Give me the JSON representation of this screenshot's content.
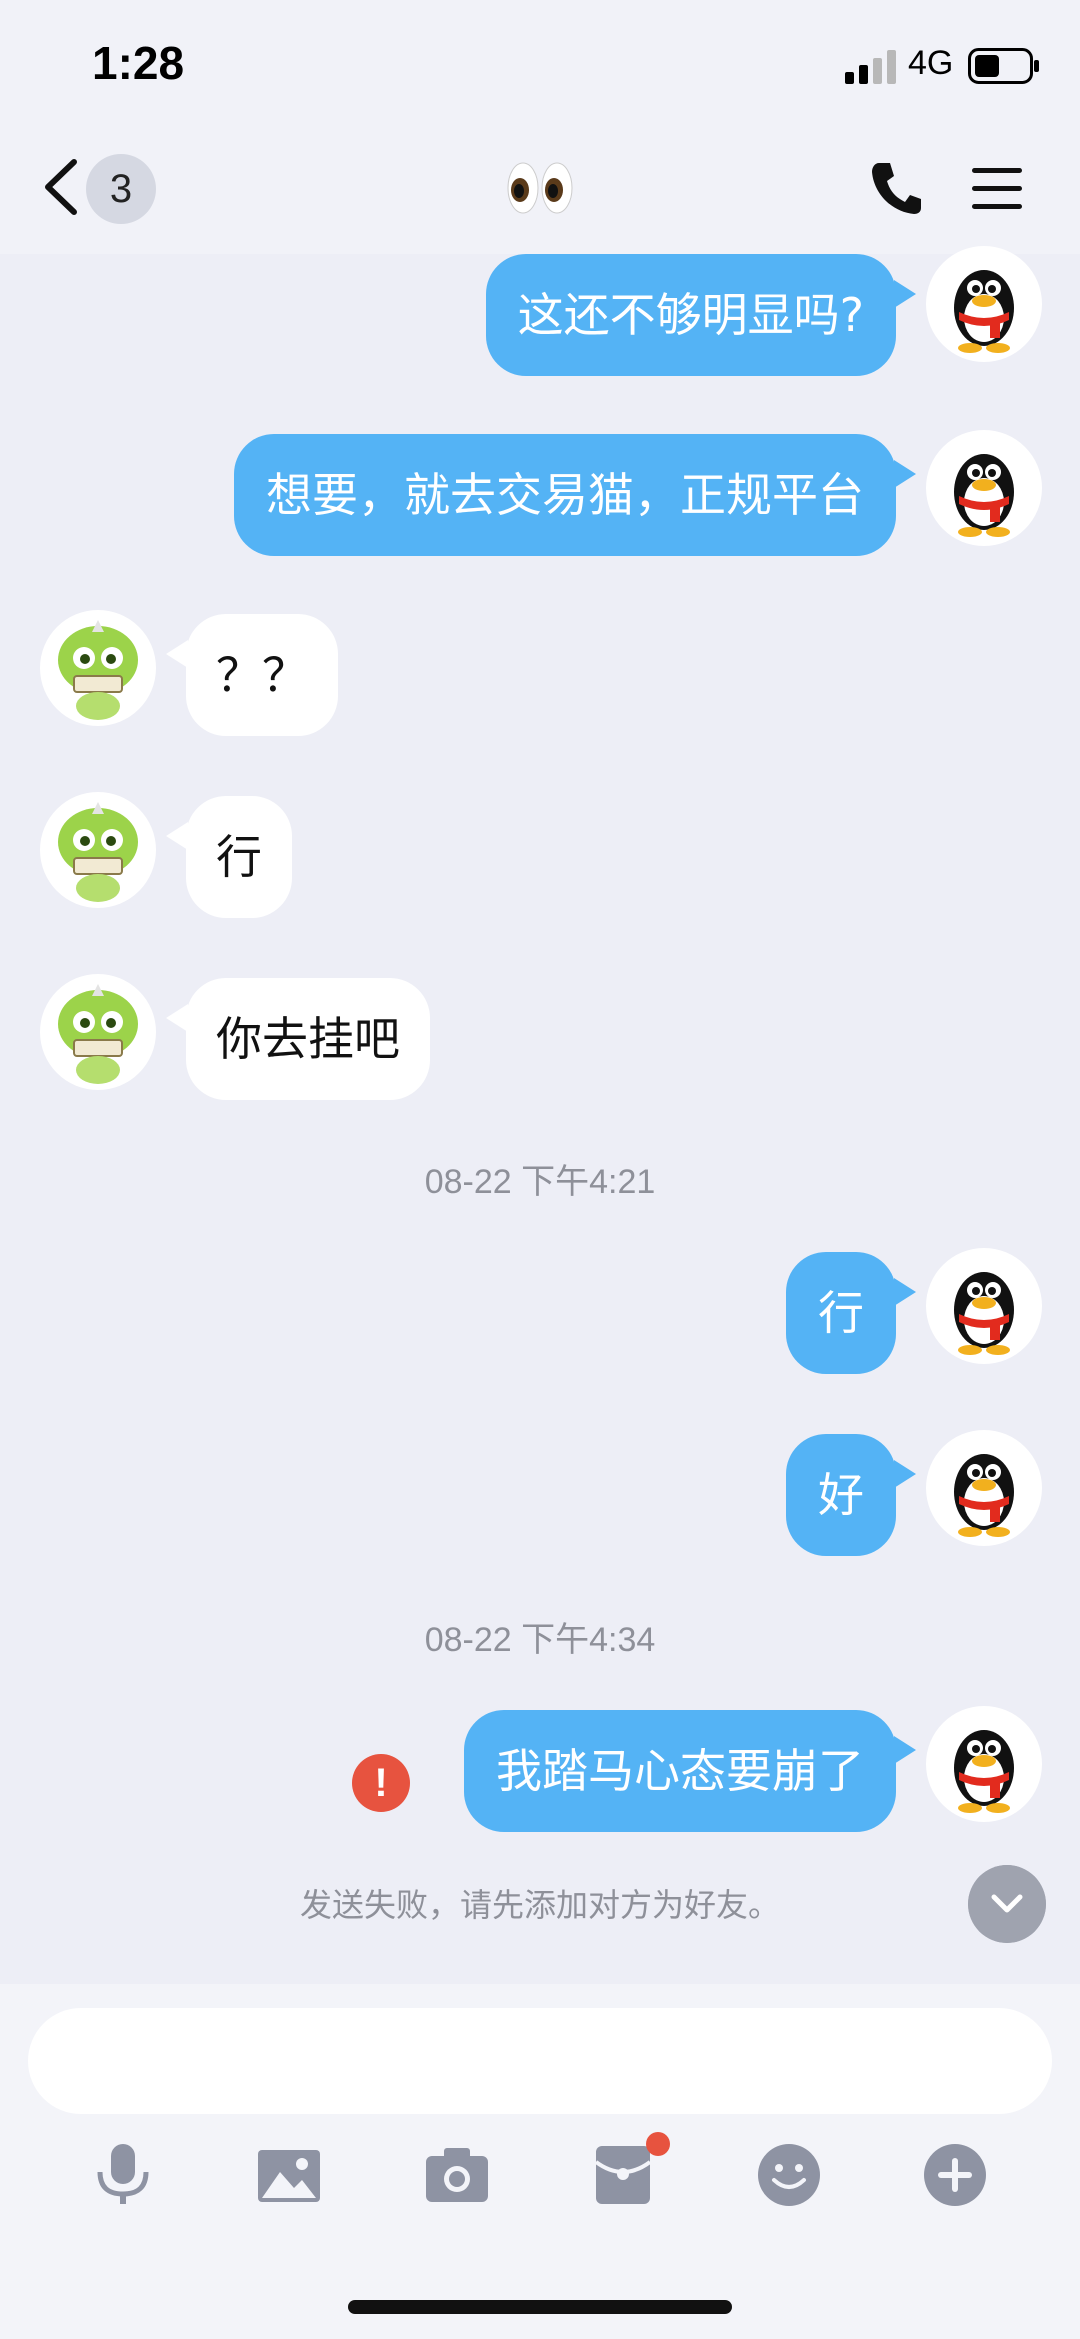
{
  "status_bar": {
    "time": "1:28",
    "network": "4G"
  },
  "header": {
    "unread_badge": "3",
    "title_icon": "eyes-emoji-icon"
  },
  "messages": [
    {
      "side": "out",
      "text": "这还不够明显吗?"
    },
    {
      "side": "out",
      "text": "想要，就去交易猫，正规平台"
    },
    {
      "side": "in",
      "text": "？？"
    },
    {
      "side": "in",
      "text": "行"
    },
    {
      "side": "in",
      "text": "你去挂吧"
    },
    {
      "type": "timestamp",
      "text": "08-22 下午4:21"
    },
    {
      "side": "out",
      "text": "行"
    },
    {
      "side": "out",
      "text": "好"
    },
    {
      "type": "timestamp",
      "text": "08-22 下午4:34"
    },
    {
      "side": "out",
      "text": "我踏马心态要崩了",
      "failed": true
    }
  ],
  "fail_notice": "发送失败，请先添加对方为好友。",
  "input": {
    "placeholder": ""
  },
  "toolbar_icons": [
    "microphone-icon",
    "image-icon",
    "camera-icon",
    "red-envelope-icon",
    "emoji-icon",
    "plus-icon"
  ],
  "colors": {
    "outgoing_bubble": "#54B3F5",
    "incoming_bubble": "#FFFFFF",
    "background": "#EDEEF6",
    "error": "#E7533F"
  }
}
